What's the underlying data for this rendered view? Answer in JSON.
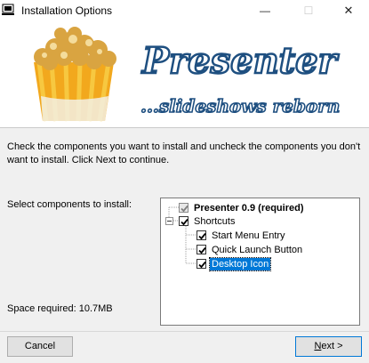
{
  "window": {
    "title": "Installation Options",
    "minimize_glyph": "—",
    "maximize_glyph": "☐",
    "close_glyph": "✕"
  },
  "banner": {
    "title": "Presenter",
    "subtitle": "...slideshows reborn",
    "image": "popcorn-bucket"
  },
  "instructions": "Check the components you want to install and uncheck the components you don't want to install. Click Next to continue.",
  "select_label": "Select components to install:",
  "space_required": "Space required: 10.7MB",
  "components": [
    {
      "label": "Presenter 0.9 (required)",
      "checked": true,
      "disabled": true,
      "bold": true
    },
    {
      "label": "Shortcuts",
      "checked": true,
      "expanded": true
    },
    {
      "label": "Start Menu Entry",
      "checked": true
    },
    {
      "label": "Quick Launch Button",
      "checked": true
    },
    {
      "label": "Desktop Icon",
      "checked": true,
      "selected": true
    }
  ],
  "buttons": {
    "cancel": "Cancel",
    "next_mnemonic": "N",
    "next_rest": "ext >"
  },
  "colors": {
    "selection": "#0078d7",
    "title_text": "#1e6fb0",
    "banner_bg": "#ffffff"
  }
}
